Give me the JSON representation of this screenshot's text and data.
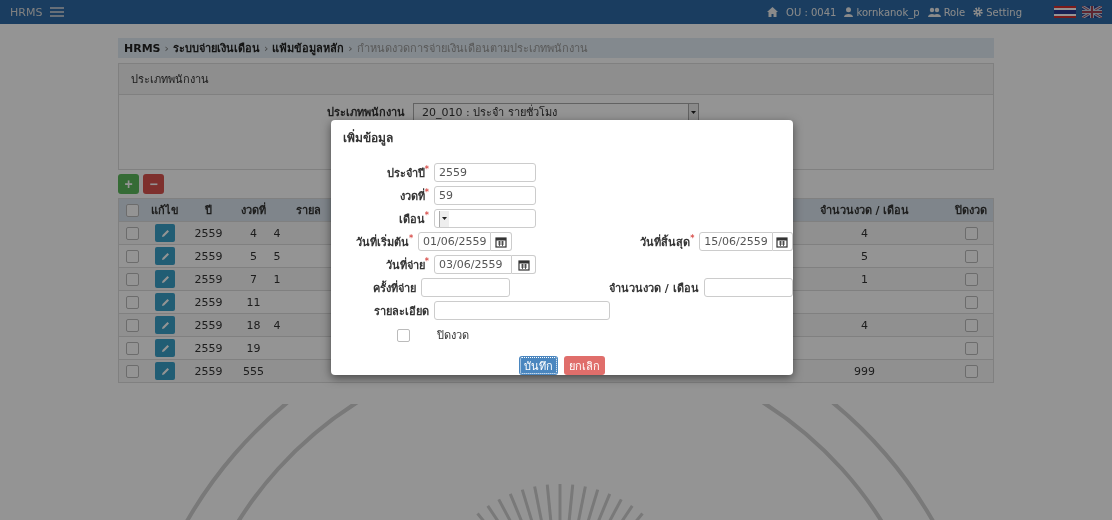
{
  "navbar": {
    "brand": "HRMS",
    "ou": "OU : 0041",
    "user": "kornkanok_p",
    "role": "Role",
    "setting": "Setting",
    "languages": [
      {
        "kind": "thai",
        "selected": true
      },
      {
        "kind": "english",
        "selected": false
      }
    ]
  },
  "breadcrumb_separator": "›",
  "breadcrumb": [
    {
      "text": "HRMS",
      "current": false
    },
    {
      "text": "ระบบจ่ายเงินเดือน",
      "current": false
    },
    {
      "text": "แฟ้มข้อมูลหลัก",
      "current": false
    },
    {
      "text": "กำหนดงวดการจ่ายเงินเดือนตามประเภทพนักงาน",
      "current": true
    }
  ],
  "panel": {
    "title": "ประเภทพนักงาน",
    "field_label": "ประเภทพนักงาน",
    "field_value": "20_010 : ประจำ รายชั่วโมง"
  },
  "toolbar": {
    "add": "+",
    "remove": "−"
  },
  "table": {
    "select_all": false,
    "columns": [
      "แก้ไข",
      "ปี",
      "งวดที่",
      "รายล",
      "จำนวนงวด / เดือน",
      "ปิดงวด"
    ],
    "rows": [
      {
        "checked": false,
        "year": "2559",
        "period": "4",
        "column_5": "4",
        "count": "4",
        "closed": false
      },
      {
        "checked": false,
        "year": "2559",
        "period": "5",
        "column_5": "5",
        "count": "5",
        "closed": false
      },
      {
        "checked": false,
        "year": "2559",
        "period": "7",
        "column_5": "1",
        "count": "1",
        "closed": false
      },
      {
        "checked": false,
        "year": "2559",
        "period": "11",
        "column_5": "",
        "count": "",
        "closed": false
      },
      {
        "checked": false,
        "year": "2559",
        "period": "18",
        "column_5": "4",
        "count": "4",
        "closed": false
      },
      {
        "checked": false,
        "year": "2559",
        "period": "19",
        "column_5": "",
        "count": "",
        "closed": false
      },
      {
        "checked": false,
        "year": "2559",
        "period": "555",
        "column_5": "",
        "count": "999",
        "closed": false
      }
    ]
  },
  "dialog": {
    "title": "เพิ่มข้อมูล",
    "rows": [
      [
        {
          "label": "ประจำปี",
          "required_mark": "*",
          "kind": "text",
          "value": "2559"
        }
      ],
      [
        {
          "label": "งวดที่",
          "required_mark": "*",
          "kind": "text",
          "value": "59"
        }
      ],
      [
        {
          "label": "เดือน",
          "required_mark": "*",
          "kind": "select"
        }
      ],
      [
        {
          "label": "วันที่เริ่มต้น",
          "required_mark": "*",
          "kind": "date",
          "value": "01/06/2559"
        },
        {
          "label": "วันที่สิ้นสุด",
          "required_mark": "*",
          "kind": "date",
          "value": "15/06/2559"
        }
      ],
      [
        {
          "label": "วันที่จ่าย",
          "required_mark": "*",
          "kind": "date",
          "value": "03/06/2559"
        }
      ],
      [
        {
          "label": "ครั้งที่จ่าย",
          "kind": "text"
        },
        {
          "label": "จำนวนงวด / เดือน",
          "kind": "text"
        }
      ],
      [
        {
          "label": "รายละเอียด",
          "kind": "wide"
        }
      ]
    ],
    "close_checkbox": {
      "label": "ปิดงวด",
      "checked": false
    },
    "save": "บันทึก",
    "cancel": "ยกเลิก"
  }
}
